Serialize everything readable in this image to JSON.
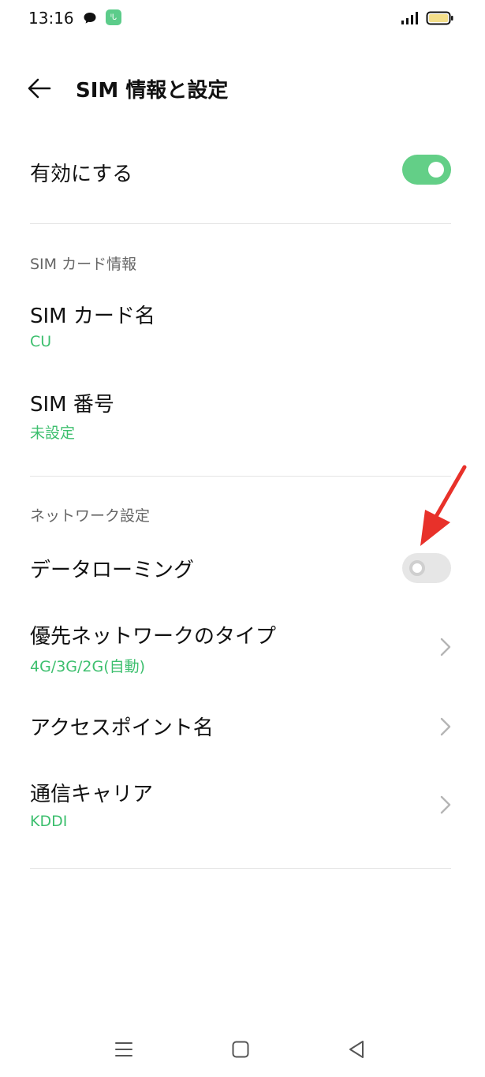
{
  "status_bar": {
    "time": "13:16",
    "badge_text": "ᑊᒐ",
    "battery_color": "#f3de8a",
    "accent_green": "#5ccc8a"
  },
  "header": {
    "title": "SIM 情報と設定",
    "back_icon": "arrow-left-icon"
  },
  "enable": {
    "label": "有効にする",
    "toggle_state": "on"
  },
  "sim_section": {
    "label": "SIM カード情報",
    "items": [
      {
        "title": "SIM カード名",
        "value": "CU"
      },
      {
        "title": "SIM 番号",
        "value": "未設定"
      }
    ]
  },
  "network_section": {
    "label": "ネットワーク設定",
    "data_roaming": {
      "label": "データローミング",
      "toggle_state": "off"
    },
    "preferred_network": {
      "title": "優先ネットワークのタイプ",
      "value": "4G/3G/2G(自動)"
    },
    "apn": {
      "title": "アクセスポイント名"
    },
    "carrier": {
      "title": "通信キャリア",
      "value": "KDDI"
    }
  },
  "colors": {
    "value_green": "#3dbf6e",
    "toggle_on": "#63cf87",
    "annotation_red": "#e8312a"
  },
  "nav_bar": {
    "icons": [
      "menu-icon",
      "home-square-icon",
      "back-triangle-icon"
    ]
  }
}
